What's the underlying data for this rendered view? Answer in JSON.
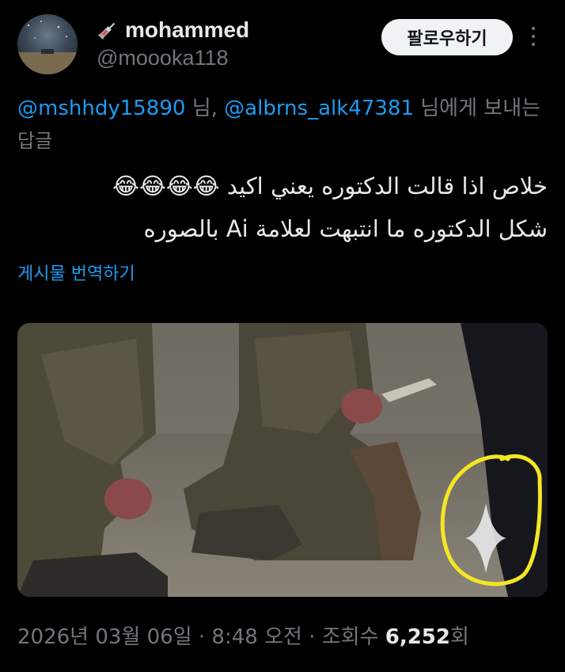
{
  "author": {
    "display_name": "mohammed",
    "handle": "@moooka118",
    "name_icon": "syringe-icon"
  },
  "header": {
    "follow_label": "팔로우하기",
    "more_icon": "more-vertical-icon"
  },
  "reply_context": {
    "mention_1": "@mshhdy15890",
    "suffix_1": " 님, ",
    "mention_2": "@albrns_alk47381",
    "suffix_2": " 님에게 보내는",
    "line_2": "답글"
  },
  "tweet": {
    "line_1": "خلاص اذا قالت الدكتوره يعني اكيد 😂😂😂😂",
    "line_2": "شكل الدكتوره ما انتبهت لعلامة Ai بالصوره",
    "translate_label": "게시물 번역하기"
  },
  "media": {
    "description_icon": "ai-sparkle-icon",
    "highlight_color": "#f5e625"
  },
  "footer": {
    "date_time": "2026년 03월 06일 · 8:48 오전 · 조회수 ",
    "views_count": "6,252",
    "views_suffix": "회"
  },
  "colors": {
    "background": "#000000",
    "text": "#e7e9ea",
    "muted": "#71767b",
    "link": "#1d9bf0",
    "button_bg": "#eff3f4"
  }
}
